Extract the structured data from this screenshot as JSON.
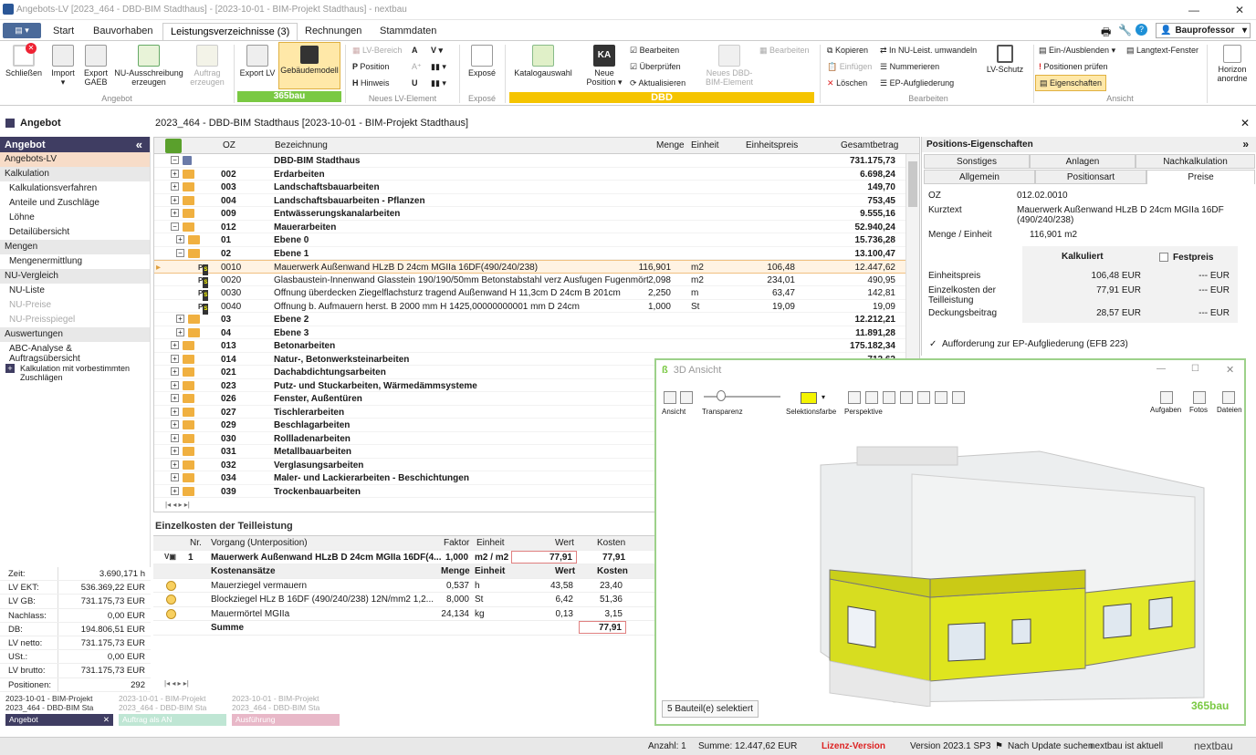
{
  "titlebar": {
    "title": "Angebots-LV [2023_464 - DBD-BIM Stadthaus] - [2023-10-01 - BIM-Projekt Stadthaus] - nextbau",
    "minimize": "—",
    "close": "✕"
  },
  "menu_tabs": [
    "Start",
    "Bauvorhaben",
    "Leistungsverzeichnisse (3)",
    "Rechnungen",
    "Stammdaten"
  ],
  "user": "Bauprofessor",
  "ribbon": {
    "schliessen": "Schließen",
    "import": "Import",
    "export_gaeb": "Export GAEB",
    "nu_ausschreibung": "NU-Ausschreibung erzeugen",
    "auftrag_erzeugen": "Auftrag erzeugen",
    "group_angebot": "Angebot",
    "export_lv": "Export LV",
    "gebaeudemodell": "Gebäudemodell",
    "brand_365": "365bau",
    "lv_bereich": "LV-Bereich",
    "position": "Position",
    "hinweis": "Hinweis",
    "group_neues": "Neues LV-Element",
    "expose": "Exposé",
    "group_expose": "Exposé",
    "katalogauswahl": "Katalogauswahl",
    "neue_position": "Neue Position",
    "bearbeiten": "Bearbeiten",
    "ueberpruefen": "Überprüfen",
    "aktualisieren": "Aktualisieren",
    "neues_dbd": "Neues DBD-BIM-Element",
    "bearbeiten2": "Bearbeiten",
    "brand_dbd": "DBD",
    "kopieren": "Kopieren",
    "einfuegen": "Einfügen",
    "loeschen": "Löschen",
    "in_nu": "In NU-Leist. umwandeln",
    "nummerieren": "Nummerieren",
    "ep_aufgliederung": "EP-Aufgliederung",
    "lv_schutz": "LV-Schutz",
    "group_bearbeiten": "Bearbeiten",
    "ein_ausblenden": "Ein-/Ausblenden",
    "langtext_fenster": "Langtext-Fenster",
    "positionen_pruefen": "Positionen prüfen",
    "eigenschaften": "Eigenschaften",
    "group_ansicht": "Ansicht",
    "horizontal": "Horizon anordne"
  },
  "left": {
    "header": "Angebot",
    "nav_header": "Angebot",
    "collapse": "«",
    "items": [
      {
        "type": "item",
        "label": "Angebots-LV",
        "sel": true
      },
      {
        "type": "sec",
        "label": "Kalkulation"
      },
      {
        "type": "item",
        "label": "Kalkulationsverfahren"
      },
      {
        "type": "item",
        "label": "Anteile und Zuschläge"
      },
      {
        "type": "item",
        "label": "Löhne"
      },
      {
        "type": "item",
        "label": "Detailübersicht"
      },
      {
        "type": "sec",
        "label": "Mengen"
      },
      {
        "type": "item",
        "label": "Mengenermittlung"
      },
      {
        "type": "sec",
        "label": "NU-Vergleich"
      },
      {
        "type": "item",
        "label": "NU-Liste"
      },
      {
        "type": "item",
        "label": "NU-Preise",
        "dis": true
      },
      {
        "type": "item",
        "label": "NU-Preisspiegel",
        "dis": true
      },
      {
        "type": "sec",
        "label": "Auswertungen"
      },
      {
        "type": "item",
        "label": "ABC-Analyse & Auftragsübersicht"
      }
    ],
    "kalk_vorbestimmt": "Kalkulation mit vorbestimmten Zuschlägen"
  },
  "stats": [
    {
      "k": "Zeit:",
      "v": "3.690,171 h"
    },
    {
      "k": "LV EKT:",
      "v": "536.369,22 EUR"
    },
    {
      "k": "LV GB:",
      "v": "731.175,73 EUR"
    },
    {
      "k": "Nachlass:",
      "v": "0,00 EUR"
    },
    {
      "k": "DB:",
      "v": "194.806,51 EUR"
    },
    {
      "k": "LV netto:",
      "v": "731.175,73 EUR"
    },
    {
      "k": "USt.:",
      "v": "0,00 EUR"
    },
    {
      "k": "LV brutto:",
      "v": "731.175,73 EUR"
    },
    {
      "k": "Positionen:",
      "v": "292"
    }
  ],
  "bottom_tabs": [
    {
      "line1": "2023-10-01 - BIM-Projekt",
      "line2": "2023_464 - DBD-BIM Sta",
      "label": "Angebot",
      "color": "#3f3d62"
    },
    {
      "line1": "2023-10-01 - BIM-Projekt",
      "line2": "2023_464 - DBD-BIM Sta",
      "label": "Auftrag als AN",
      "color": "#bfe6d4"
    },
    {
      "line1": "2023-10-01 - BIM-Projekt",
      "line2": "2023_464 - DBD-BIM Sta",
      "label": "Ausführung",
      "color": "#e8b8c8"
    }
  ],
  "doc_title": "2023_464 - DBD-BIM Stadthaus [2023-10-01 - BIM-Projekt Stadthaus]",
  "grid": {
    "headers": {
      "oz": "OZ",
      "bez": "Bezeichnung",
      "menge": "Menge",
      "einheit": "Einheit",
      "ep": "Einheitspreis",
      "gb": "Gesamtbetrag"
    },
    "rows": [
      {
        "lvl": 0,
        "exp": "−",
        "icon": "root",
        "oz": "",
        "bez": "DBD-BIM Stadthaus",
        "menge": "",
        "einheit": "",
        "ep": "",
        "gb": "731.175,73",
        "bold": true
      },
      {
        "lvl": 0,
        "exp": "+",
        "icon": "fold",
        "oz": "002",
        "bez": "Erdarbeiten",
        "gb": "6.698,24",
        "bold": true
      },
      {
        "lvl": 0,
        "exp": "+",
        "icon": "fold",
        "oz": "003",
        "bez": "Landschaftsbauarbeiten",
        "gb": "149,70",
        "bold": true
      },
      {
        "lvl": 0,
        "exp": "+",
        "icon": "fold",
        "oz": "004",
        "bez": "Landschaftsbauarbeiten - Pflanzen",
        "gb": "753,45",
        "bold": true
      },
      {
        "lvl": 0,
        "exp": "+",
        "icon": "fold",
        "oz": "009",
        "bez": "Entwässerungskanalarbeiten",
        "gb": "9.555,16",
        "bold": true
      },
      {
        "lvl": 0,
        "exp": "−",
        "icon": "fold",
        "oz": "012",
        "bez": "Mauerarbeiten",
        "gb": "52.940,24",
        "bold": true
      },
      {
        "lvl": 1,
        "exp": "+",
        "icon": "fold",
        "oz": "01",
        "bez": "Ebene 0",
        "gb": "15.736,28",
        "bold": true
      },
      {
        "lvl": 1,
        "exp": "−",
        "icon": "fold",
        "oz": "02",
        "bez": "Ebene 1",
        "gb": "13.100,47",
        "bold": true
      },
      {
        "lvl": 2,
        "icon": "pos",
        "oz": "0010",
        "bez": "Mauerwerk Außenwand HLzB D 24cm MGIIa 16DF(490/240/238)",
        "menge": "116,901",
        "einheit": "m2",
        "ep": "106,48",
        "gb": "12.447,62",
        "sel": true
      },
      {
        "lvl": 2,
        "icon": "pos",
        "oz": "0020",
        "bez": "Glasbaustein-Innenwand Glasstein 190/190/50mm Betonstabstahl verz Ausfugen Fugenmört...",
        "menge": "2,098",
        "einheit": "m2",
        "ep": "234,01",
        "gb": "490,95"
      },
      {
        "lvl": 2,
        "icon": "pos",
        "oz": "0030",
        "bez": "Öffnung überdecken Ziegelflachsturz tragend Außenwand H 11,3cm D 24cm B 201cm",
        "menge": "2,250",
        "einheit": "m",
        "ep": "63,47",
        "gb": "142,81"
      },
      {
        "lvl": 2,
        "icon": "pos",
        "oz": "0040",
        "bez": "Öffnung b. Aufmauern herst. B 2000 mm H 1425,00000000001 mm D 24cm",
        "menge": "1,000",
        "einheit": "St",
        "ep": "19,09",
        "gb": "19,09"
      },
      {
        "lvl": 1,
        "exp": "+",
        "icon": "fold",
        "oz": "03",
        "bez": "Ebene 2",
        "gb": "12.212,21",
        "bold": true
      },
      {
        "lvl": 1,
        "exp": "+",
        "icon": "fold",
        "oz": "04",
        "bez": "Ebene 3",
        "gb": "11.891,28",
        "bold": true
      },
      {
        "lvl": 0,
        "exp": "+",
        "icon": "fold",
        "oz": "013",
        "bez": "Betonarbeiten",
        "gb": "175.182,34",
        "bold": true
      },
      {
        "lvl": 0,
        "exp": "+",
        "icon": "fold",
        "oz": "014",
        "bez": "Natur-, Betonwerksteinarbeiten",
        "gb": "712,62",
        "bold": true
      },
      {
        "lvl": 0,
        "exp": "+",
        "icon": "fold",
        "oz": "021",
        "bez": "Dachabdichtungsarbeiten",
        "gb": "",
        "bold": true
      },
      {
        "lvl": 0,
        "exp": "+",
        "icon": "fold",
        "oz": "023",
        "bez": "Putz- und Stuckarbeiten, Wärmedämmsysteme",
        "gb": "",
        "bold": true
      },
      {
        "lvl": 0,
        "exp": "+",
        "icon": "fold",
        "oz": "026",
        "bez": "Fenster, Außentüren",
        "gb": "",
        "bold": true
      },
      {
        "lvl": 0,
        "exp": "+",
        "icon": "fold",
        "oz": "027",
        "bez": "Tischlerarbeiten",
        "gb": "",
        "bold": true
      },
      {
        "lvl": 0,
        "exp": "+",
        "icon": "fold",
        "oz": "029",
        "bez": "Beschlagarbeiten",
        "gb": "",
        "bold": true
      },
      {
        "lvl": 0,
        "exp": "+",
        "icon": "fold",
        "oz": "030",
        "bez": "Rollladenarbeiten",
        "gb": "",
        "bold": true
      },
      {
        "lvl": 0,
        "exp": "+",
        "icon": "fold",
        "oz": "031",
        "bez": "Metallbauarbeiten",
        "gb": "",
        "bold": true
      },
      {
        "lvl": 0,
        "exp": "+",
        "icon": "fold",
        "oz": "032",
        "bez": "Verglasungsarbeiten",
        "gb": "",
        "bold": true
      },
      {
        "lvl": 0,
        "exp": "+",
        "icon": "fold",
        "oz": "034",
        "bez": "Maler- und Lackierarbeiten - Beschichtungen",
        "gb": "",
        "bold": true
      },
      {
        "lvl": 0,
        "exp": "+",
        "icon": "fold",
        "oz": "039",
        "bez": "Trockenbauarbeiten",
        "gb": "",
        "bold": true
      }
    ]
  },
  "cost": {
    "title": "Einzelkosten der Teilleistung",
    "headers": {
      "nr": "Nr.",
      "vorgang": "Vorgang (Unterposition)",
      "faktor": "Faktor",
      "einheit": "Einheit",
      "wert": "Wert",
      "kosten": "Kosten"
    },
    "main": {
      "nr": "1",
      "vorgang": "Mauerwerk Außenwand HLzB D 24cm MGIIa 16DF(4...",
      "faktor": "1,000",
      "einheit": "m2 / m2",
      "wert": "77,91",
      "kosten": "77,91"
    },
    "sub_headers": {
      "k": "Kostenansätze",
      "menge": "Menge",
      "einheit": "Einheit",
      "wert": "Wert",
      "kosten": "Kosten"
    },
    "items": [
      {
        "label": "Mauerziegel vermauern",
        "menge": "0,537",
        "einheit": "h",
        "wert": "43,58",
        "kosten": "23,40"
      },
      {
        "label": "Blockziegel HLz B 16DF (490/240/238) 12N/mm2 1,2...",
        "menge": "8,000",
        "einheit": "St",
        "wert": "6,42",
        "kosten": "51,36"
      },
      {
        "label": "Mauermörtel MGIIa",
        "menge": "24,134",
        "einheit": "kg",
        "wert": "0,13",
        "kosten": "3,15"
      }
    ],
    "summe_label": "Summe",
    "summe": "77,91"
  },
  "props": {
    "title": "Positions-Eigenschaften",
    "tabs_row1": [
      "Sonstiges",
      "Anlagen",
      "Nachkalkulation"
    ],
    "tabs_row2": [
      "Allgemein",
      "Positionsart",
      "Preise"
    ],
    "oz_label": "OZ",
    "oz": "012.02.0010",
    "kurztext_label": "Kurztext",
    "kurztext": "Mauerwerk Außenwand HLzB D 24cm MGIIa 16DF (490/240/238)",
    "menge_label": "Menge / Einheit",
    "menge": "116,901 m2",
    "kalkuliert": "Kalkuliert",
    "festpreis": "Festpreis",
    "ep_label": "Einheitspreis",
    "ep": "106,48 EUR",
    "ep_fp": "--- EUR",
    "ekt_label": "Einzelkosten der Teilleistung",
    "ekt": "77,91 EUR",
    "ekt_fp": "--- EUR",
    "db_label": "Deckungsbeitrag",
    "db": "28,57 EUR",
    "db_fp": "--- EUR",
    "aufforderung": "Aufforderung zur EP-Aufgliederung (EFB 223)"
  },
  "view3d": {
    "title": "3D Ansicht",
    "ansicht": "Ansicht",
    "transparenz": "Transparenz",
    "selektionsfarbe": "Selektionsfarbe",
    "perspektive": "Perspektive",
    "aufgaben": "Aufgaben",
    "fotos": "Fotos",
    "dateien": "Dateien",
    "selected": "5 Bauteil(e) selektiert",
    "brand": "365bau",
    "selection_color": "#f4f400"
  },
  "status": {
    "anzahl": "Anzahl: 1",
    "summe": "Summe: 12.447,62 EUR",
    "lizenz": "Lizenz-Version",
    "version": "Version 2023.1 SP3",
    "update": "Nach Update suchen",
    "aktuell": "nextbau ist aktuell",
    "brand": "nextbau"
  }
}
